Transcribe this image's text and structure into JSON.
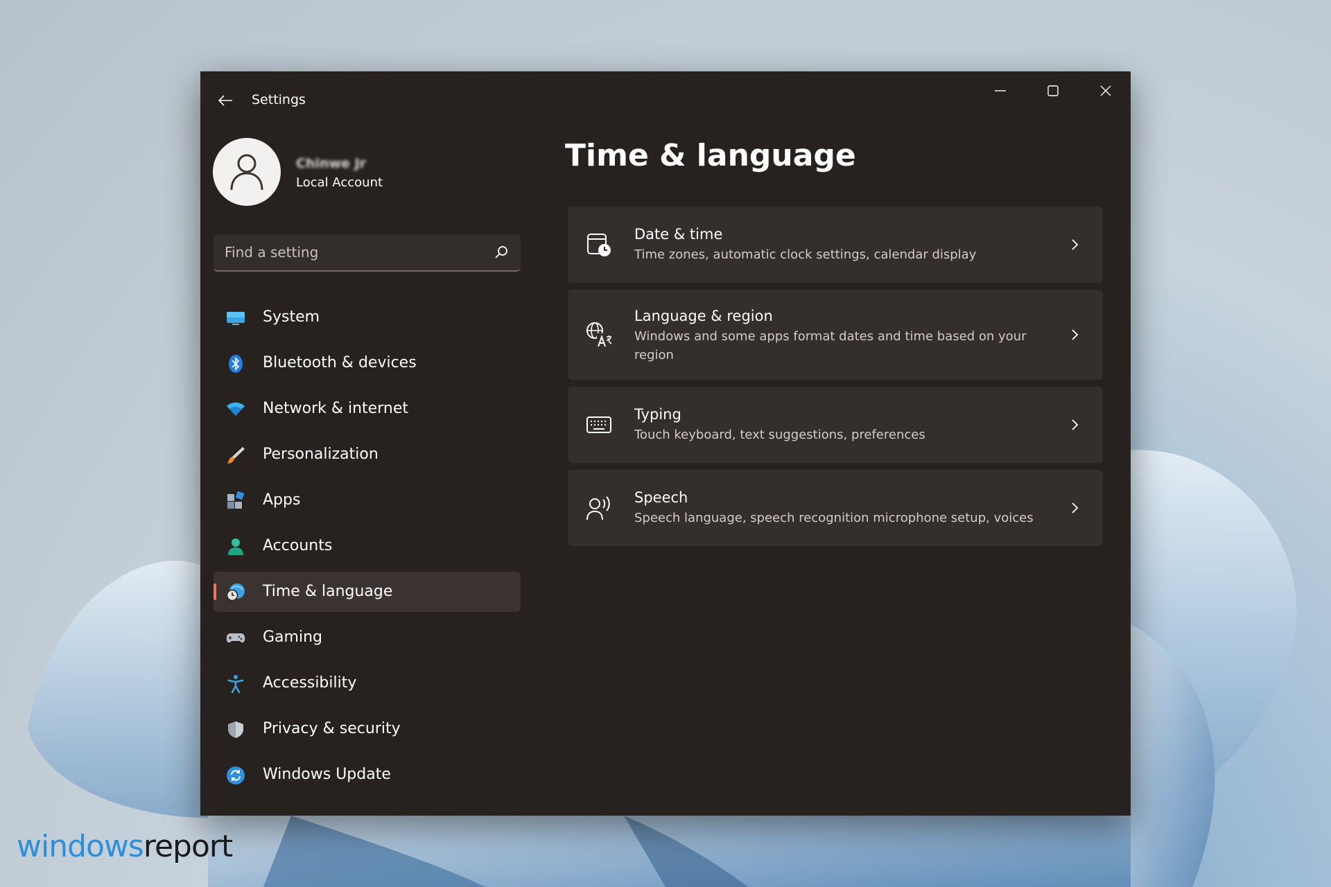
{
  "window": {
    "title": "Settings"
  },
  "profile": {
    "name": "Chinwe Jr",
    "account_type": "Local Account"
  },
  "search": {
    "placeholder": "Find a setting"
  },
  "nav": {
    "items": [
      {
        "label": "System",
        "icon": "monitor-icon"
      },
      {
        "label": "Bluetooth & devices",
        "icon": "bluetooth-icon"
      },
      {
        "label": "Network & internet",
        "icon": "wifi-icon"
      },
      {
        "label": "Personalization",
        "icon": "brush-icon"
      },
      {
        "label": "Apps",
        "icon": "apps-icon"
      },
      {
        "label": "Accounts",
        "icon": "person-icon"
      },
      {
        "label": "Time & language",
        "icon": "globe-clock-icon",
        "active": true
      },
      {
        "label": "Gaming",
        "icon": "gamepad-icon"
      },
      {
        "label": "Accessibility",
        "icon": "accessibility-icon"
      },
      {
        "label": "Privacy & security",
        "icon": "shield-icon"
      },
      {
        "label": "Windows Update",
        "icon": "update-icon"
      }
    ]
  },
  "main": {
    "title": "Time & language",
    "cards": [
      {
        "title": "Date & time",
        "description": "Time zones, automatic clock settings, calendar display",
        "icon": "calendar-clock-icon"
      },
      {
        "title": "Language & region",
        "description": "Windows and some apps format dates and time based on your region",
        "icon": "language-icon"
      },
      {
        "title": "Typing",
        "description": "Touch keyboard, text suggestions, preferences",
        "icon": "keyboard-icon"
      },
      {
        "title": "Speech",
        "description": "Speech language, speech recognition microphone setup, voices",
        "icon": "speech-icon"
      }
    ]
  },
  "watermark": {
    "part1": "windows",
    "part2": "report"
  },
  "colors": {
    "window_bg": "#272220",
    "card_bg": "#342e2c",
    "accent": "#e8785a"
  }
}
